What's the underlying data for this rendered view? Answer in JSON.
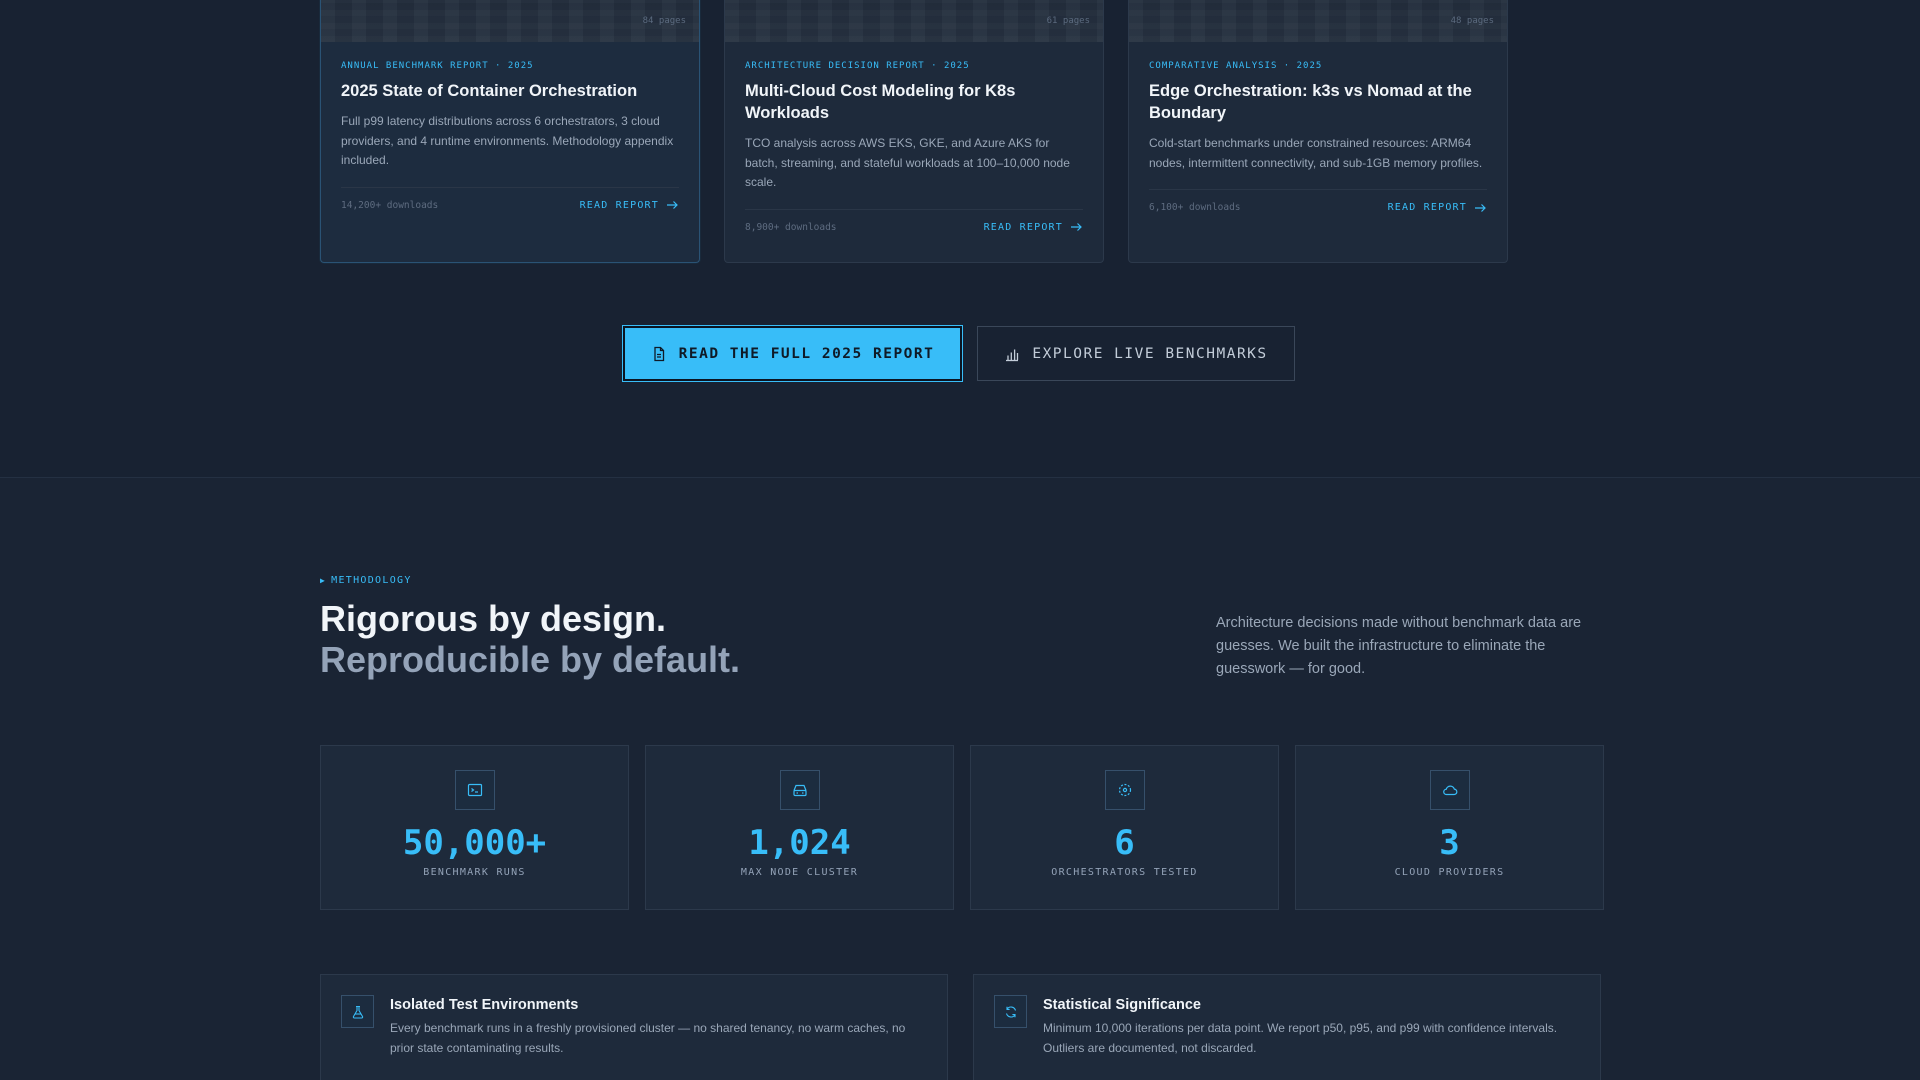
{
  "reports": [
    {
      "pages": "84 pages",
      "kicker": "ANNUAL BENCHMARK REPORT · 2025",
      "title": "2025 State of Container Orchestration",
      "description": "Full p99 latency distributions across 6 orchestrators, 3 cloud providers, and 4 runtime environments. Methodology appendix included.",
      "downloads": "14,200+ downloads",
      "link": "READ REPORT"
    },
    {
      "pages": "61 pages",
      "kicker": "ARCHITECTURE DECISION REPORT · 2025",
      "title": "Multi-Cloud Cost Modeling for K8s Workloads",
      "description": "TCO analysis across AWS EKS, GKE, and Azure AKS for batch, streaming, and stateful workloads at 100–10,000 node scale.",
      "downloads": "8,900+ downloads",
      "link": "READ REPORT"
    },
    {
      "pages": "48 pages",
      "kicker": "COMPARATIVE ANALYSIS · 2025",
      "title": "Edge Orchestration: k3s vs Nomad at the Boundary",
      "description": "Cold-start benchmarks under constrained resources: ARM64 nodes, intermittent connectivity, and sub-1GB memory profiles.",
      "downloads": "6,100+ downloads",
      "link": "READ REPORT"
    }
  ],
  "cta": {
    "primary_label": "READ THE FULL 2025 REPORT",
    "primary_icon": "document-icon",
    "secondary_label": "EXPLORE LIVE BENCHMARKS",
    "secondary_icon": "bar-chart-icon"
  },
  "methodology": {
    "eyebrow": "METHODOLOGY",
    "headline_line1": "Rigorous by design.",
    "headline_line2": "Reproducible by default.",
    "intro": "Architecture decisions made without benchmark data are guesses. We built the infrastructure to eliminate the guesswork — for good."
  },
  "stats": [
    {
      "icon": "terminal-icon",
      "value": "50,000+",
      "label": "BENCHMARK RUNS"
    },
    {
      "icon": "server-icon",
      "value": "1,024",
      "label": "MAX NODE CLUSTER"
    },
    {
      "icon": "cluster-icon",
      "value": "6",
      "label": "ORCHESTRATORS TESTED"
    },
    {
      "icon": "cloud-icon",
      "value": "3",
      "label": "CLOUD PROVIDERS"
    }
  ],
  "features": [
    {
      "icon": "flask-icon",
      "title": "Isolated Test Environments",
      "description": "Every benchmark runs in a freshly provisioned cluster — no shared tenancy, no warm caches, no prior state contaminating results."
    },
    {
      "icon": "refresh-icon",
      "title": "Statistical Significance",
      "description": "Minimum 10,000 iterations per data point. We report p50, p95, and p99 with confidence intervals. Outliers are documented, not discarded."
    }
  ],
  "colors": {
    "accent": "#38bdf8",
    "background": "#182232",
    "card": "#1e2a3b"
  }
}
